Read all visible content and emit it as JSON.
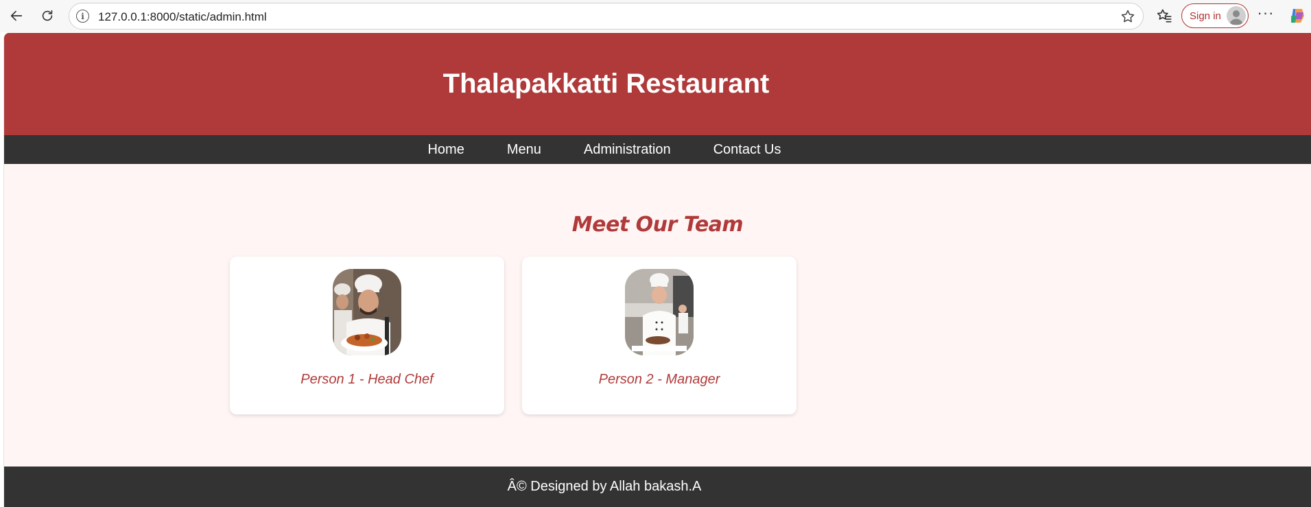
{
  "browser": {
    "url": "127.0.0.1:8000/static/admin.html",
    "signin_label": "Sign in"
  },
  "header": {
    "title": "Thalapakkatti Restaurant"
  },
  "nav": {
    "items": [
      {
        "label": "Home"
      },
      {
        "label": "Menu"
      },
      {
        "label": "Administration"
      },
      {
        "label": "Contact Us"
      }
    ]
  },
  "team": {
    "heading": "Meet Our Team",
    "members": [
      {
        "caption": "Person 1 - Head Chef"
      },
      {
        "caption": "Person 2 - Manager"
      }
    ]
  },
  "footer": {
    "text": "Â© Designed by Allah bakash.A"
  },
  "colors": {
    "brand_red": "#b03a3a",
    "nav_dark": "#333333",
    "page_bg": "#fff5f4"
  }
}
